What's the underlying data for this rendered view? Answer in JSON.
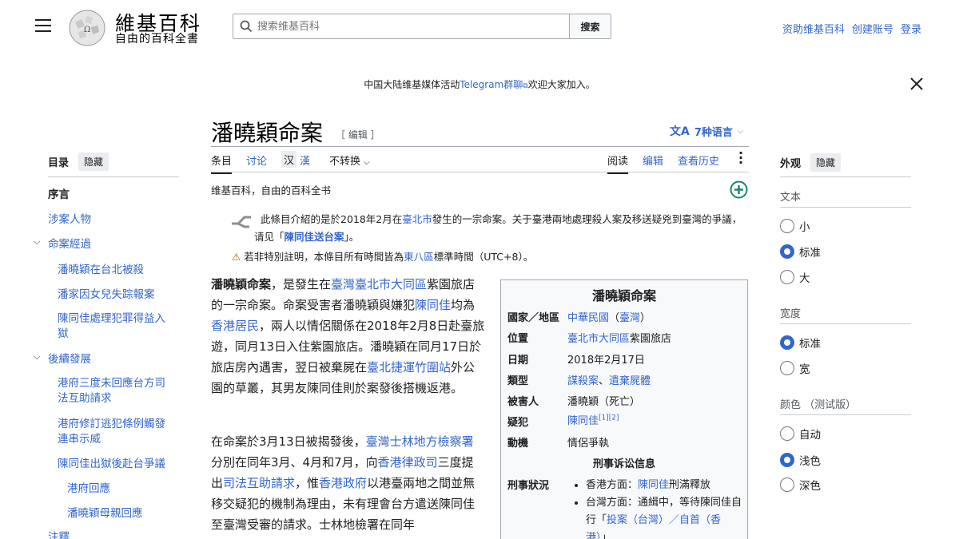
{
  "header": {
    "wordmark": "維基百科",
    "tagline": "自由的百科全書",
    "search_placeholder": "搜索维基百科",
    "search_button": "搜索",
    "links": [
      "资助维基百科",
      "创建账号",
      "登录"
    ]
  },
  "banner": {
    "prefix": "中国大陆维基媒体活动",
    "link": "Telegram群聊",
    "suffix": "欢迎大家加入。"
  },
  "toc": {
    "title": "目录",
    "hide": "隐藏",
    "items": [
      {
        "label": "序言"
      },
      {
        "label": "涉案人物"
      },
      {
        "label": "案經過"
      },
      {
        "label": "潘曉穎在台北被殺"
      },
      {
        "label": "潘家因女兒失踪報案"
      },
      {
        "label": "陳同佳處理犯罪得益入獄"
      },
      {
        "label": "後續發展"
      },
      {
        "label": "港府三度未回應台方司法互助請求"
      },
      {
        "label": "港府修訂逃犯條例觸發連串示威"
      },
      {
        "label": "陳同佳出獄後赴台爭議"
      },
      {
        "label": "港府回應"
      },
      {
        "label": "潘曉穎母親回應"
      },
      {
        "label": "注釋"
      }
    ]
  },
  "article": {
    "title": "潘曉穎命案",
    "edit": "［ 编辑 ］",
    "languages": "7种语言",
    "tabs": [
      "条目",
      "讨论",
      "汉",
      "漢",
      "不转换",
      "阅读",
      "编辑",
      "查看历史"
    ],
    "from": "维基百科，自由的百科全书",
    "hatnote1": {
      "a": "此條目介紹的是於2018年2月在",
      "b": "臺北市",
      "c": "發生的一宗命案。关于臺港兩地處理殺人案及移送疑兇到臺灣的爭議，请见「",
      "d": "陳同佳送台案",
      "e": "」。"
    },
    "hatnote2": {
      "a": "若非特別註明，本條目所有時間皆為",
      "b": "東八區",
      "c": "標準時間（UTC+8）。"
    },
    "p1": {
      "bold": "潘曉穎命案",
      "t1": "，是發生在",
      "l1": "臺灣臺北市大同區",
      "t2": "紫園旅店的一宗命案。命案受害者潘曉穎與嫌犯",
      "l2": "陳同佳",
      "t3": "均為",
      "l3": "香港居民",
      "t4": "，兩人以情侶關係在2018年2月8日赴臺旅遊，同月13日入住紫園旅店。潘曉穎在同月17日於旅店房內遇害，翌日被棄屍在",
      "l4": "臺北捷運竹圍站",
      "t5": "外公園的草叢，其男友陳同佳則於案發後搭機返港。"
    },
    "p2": {
      "t1": "在命案於3月13日被揭發後，",
      "l1": "臺灣士林地方檢察署",
      "t2": "分別在同年3月、4月和7月，向",
      "l2": "香港律政司",
      "t3": "三度提出",
      "l3": "司法互助請求",
      "t4": "，惟",
      "l4": "香港政府",
      "t5": "以港臺兩地之間並無移交疑犯的機制為理由，未有理會台方遣送陳同佳至臺灣受審的請求。士林地檢署在同年"
    }
  },
  "infobox": {
    "title": "潘曉穎命案",
    "rows": [
      {
        "key": "國家／地區",
        "v1": "中華民國",
        "v2": "（",
        "v3": "臺灣",
        "v4": "）"
      },
      {
        "key": "位置",
        "v1": "臺北市大同區",
        "v2": "紫園旅店"
      },
      {
        "key": "日期",
        "v1": "2018年2月17日"
      },
      {
        "key": "類型",
        "v1": "謀殺案",
        "v2": "、",
        "v3": "遺棄屍體"
      },
      {
        "key": "被害人",
        "v1": "潘曉穎（死亡）"
      },
      {
        "key": "疑犯",
        "v1": "陳同佳",
        "sup": "[1][2]"
      },
      {
        "key": "動機",
        "v1": "情侶爭執"
      }
    ],
    "subheader": "刑事诉讼信息",
    "status_key": "刑事狀況",
    "status": [
      {
        "a": "香港方面：",
        "b": "陳同佳",
        "c": "刑滿釋放"
      },
      {
        "a": "台灣方面：通緝中，等待陳同佳自行「",
        "b": "投案（台灣）／自首（香港）",
        "c": "」"
      }
    ]
  },
  "appearance": {
    "title": "外观",
    "hide": "隐藏",
    "text_label": "文本",
    "text_options": [
      "小",
      "标准",
      "大"
    ],
    "text_selected": 1,
    "width_label": "宽度",
    "width_options": [
      "标准",
      "宽"
    ],
    "width_selected": 0,
    "color_label": "颜色 （测试版）",
    "color_options": [
      "自动",
      "浅色",
      "深色"
    ],
    "color_selected": 1
  },
  "colors": {
    "link": "#3366cc",
    "text": "#202122",
    "accent_green": "#14866d"
  }
}
